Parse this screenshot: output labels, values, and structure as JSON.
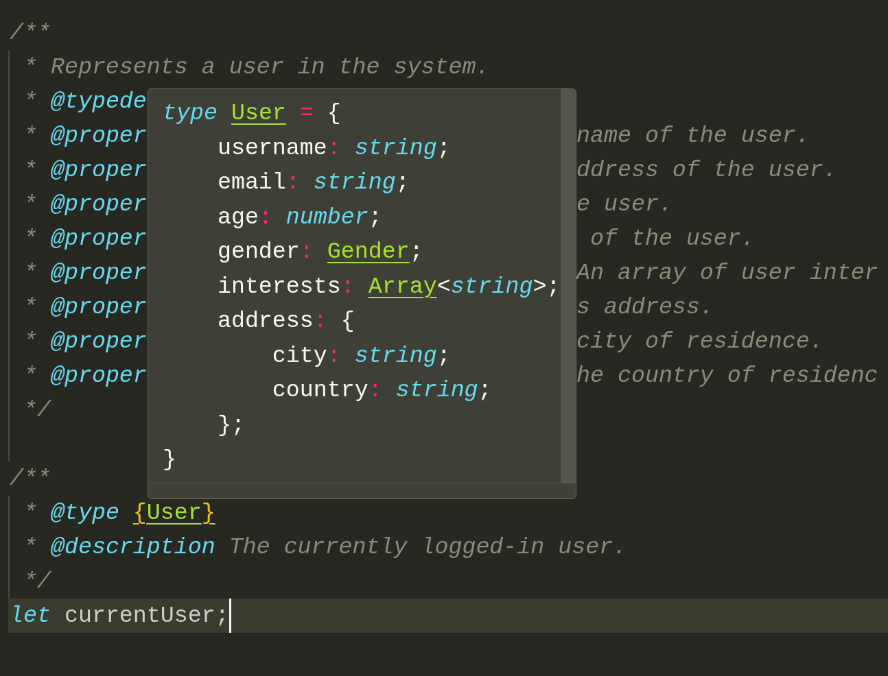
{
  "editor": {
    "lines": [
      {
        "indent_guide": false,
        "current": false,
        "left": [
          {
            "kind": "comment",
            "text": "/**"
          }
        ]
      },
      {
        "indent_guide": true,
        "current": false,
        "left": [
          {
            "kind": "comment",
            "text": " * Represents a user in the system."
          }
        ]
      },
      {
        "indent_guide": true,
        "current": false,
        "left": [
          {
            "kind": "comment",
            "text": " * "
          },
          {
            "kind": "tag",
            "text": "@typede"
          }
        ]
      },
      {
        "indent_guide": true,
        "current": false,
        "left": [
          {
            "kind": "comment",
            "text": " * "
          },
          {
            "kind": "tag",
            "text": "@proper"
          }
        ],
        "right": [
          {
            "kind": "comment",
            "text": "name of the user."
          }
        ]
      },
      {
        "indent_guide": true,
        "current": false,
        "left": [
          {
            "kind": "comment",
            "text": " * "
          },
          {
            "kind": "tag",
            "text": "@proper"
          }
        ],
        "right": [
          {
            "kind": "comment",
            "text": "ddress of the user."
          }
        ]
      },
      {
        "indent_guide": true,
        "current": false,
        "left": [
          {
            "kind": "comment",
            "text": " * "
          },
          {
            "kind": "tag",
            "text": "@proper"
          }
        ],
        "right": [
          {
            "kind": "comment",
            "text": "e user."
          }
        ]
      },
      {
        "indent_guide": true,
        "current": false,
        "left": [
          {
            "kind": "comment",
            "text": " * "
          },
          {
            "kind": "tag",
            "text": "@proper"
          }
        ],
        "right": [
          {
            "kind": "comment",
            "text": " of the user."
          }
        ]
      },
      {
        "indent_guide": true,
        "current": false,
        "left": [
          {
            "kind": "comment",
            "text": " * "
          },
          {
            "kind": "tag",
            "text": "@proper"
          }
        ],
        "right": [
          {
            "kind": "comment",
            "text": "An array of user inter"
          }
        ]
      },
      {
        "indent_guide": true,
        "current": false,
        "left": [
          {
            "kind": "comment",
            "text": " * "
          },
          {
            "kind": "tag",
            "text": "@proper"
          }
        ],
        "right": [
          {
            "kind": "comment",
            "text": "s address."
          }
        ]
      },
      {
        "indent_guide": true,
        "current": false,
        "left": [
          {
            "kind": "comment",
            "text": " * "
          },
          {
            "kind": "tag",
            "text": "@proper"
          }
        ],
        "right": [
          {
            "kind": "comment",
            "text": "city of residence."
          }
        ]
      },
      {
        "indent_guide": true,
        "current": false,
        "left": [
          {
            "kind": "comment",
            "text": " * "
          },
          {
            "kind": "tag",
            "text": "@proper"
          }
        ],
        "right": [
          {
            "kind": "comment",
            "text": "he country of residenc"
          }
        ]
      },
      {
        "indent_guide": true,
        "current": false,
        "left": [
          {
            "kind": "comment",
            "text": " */"
          }
        ]
      },
      {
        "indent_guide": true,
        "current": false
      },
      {
        "indent_guide": false,
        "current": false,
        "left": [
          {
            "kind": "comment",
            "text": "/**"
          }
        ]
      },
      {
        "indent_guide": true,
        "current": false,
        "left": [
          {
            "kind": "comment",
            "text": " * "
          },
          {
            "kind": "tag",
            "text": "@type "
          },
          {
            "kind": "bracket",
            "text": "{"
          },
          {
            "kind": "type_link",
            "text": "User"
          },
          {
            "kind": "bracket",
            "text": "}"
          }
        ]
      },
      {
        "indent_guide": true,
        "current": false,
        "left": [
          {
            "kind": "comment",
            "text": " * "
          },
          {
            "kind": "tag",
            "text": "@description"
          },
          {
            "kind": "comment",
            "text": " The currently logged-in user."
          }
        ]
      },
      {
        "indent_guide": true,
        "current": false,
        "left": [
          {
            "kind": "comment",
            "text": " */"
          }
        ]
      },
      {
        "indent_guide": false,
        "current": true,
        "left": [
          {
            "kind": "keyword",
            "text": "let"
          },
          {
            "kind": "plain",
            "text": " currentUser;"
          }
        ]
      }
    ]
  },
  "hover_tooltip": {
    "lines": [
      [
        {
          "kind": "keyword",
          "text": "type "
        },
        {
          "kind": "type_link",
          "text": "User"
        },
        {
          "kind": "operator",
          "text": " ="
        },
        {
          "kind": "punct",
          "text": " {"
        }
      ],
      [
        {
          "kind": "punct",
          "text": "    username"
        },
        {
          "kind": "operator",
          "text": ": "
        },
        {
          "kind": "builtin",
          "text": "string"
        },
        {
          "kind": "punct",
          "text": ";"
        }
      ],
      [
        {
          "kind": "punct",
          "text": "    email"
        },
        {
          "kind": "operator",
          "text": ": "
        },
        {
          "kind": "builtin",
          "text": "string"
        },
        {
          "kind": "punct",
          "text": ";"
        }
      ],
      [
        {
          "kind": "punct",
          "text": "    age"
        },
        {
          "kind": "operator",
          "text": ": "
        },
        {
          "kind": "builtin",
          "text": "number"
        },
        {
          "kind": "punct",
          "text": ";"
        }
      ],
      [
        {
          "kind": "punct",
          "text": "    gender"
        },
        {
          "kind": "operator",
          "text": ": "
        },
        {
          "kind": "type_link",
          "text": "Gender"
        },
        {
          "kind": "punct",
          "text": ";"
        }
      ],
      [
        {
          "kind": "punct",
          "text": "    interests"
        },
        {
          "kind": "operator",
          "text": ": "
        },
        {
          "kind": "type_link",
          "text": "Array"
        },
        {
          "kind": "punct",
          "text": "<"
        },
        {
          "kind": "builtin",
          "text": "string"
        },
        {
          "kind": "punct",
          "text": ">;"
        }
      ],
      [
        {
          "kind": "punct",
          "text": "    address"
        },
        {
          "kind": "operator",
          "text": ":"
        },
        {
          "kind": "punct",
          "text": " {"
        }
      ],
      [
        {
          "kind": "punct",
          "text": "        city"
        },
        {
          "kind": "operator",
          "text": ": "
        },
        {
          "kind": "builtin",
          "text": "string"
        },
        {
          "kind": "punct",
          "text": ";"
        }
      ],
      [
        {
          "kind": "punct",
          "text": "        country"
        },
        {
          "kind": "operator",
          "text": ": "
        },
        {
          "kind": "builtin",
          "text": "string"
        },
        {
          "kind": "punct",
          "text": ";"
        }
      ],
      [
        {
          "kind": "punct",
          "text": "    };"
        }
      ],
      [
        {
          "kind": "punct",
          "text": "}"
        }
      ]
    ]
  }
}
